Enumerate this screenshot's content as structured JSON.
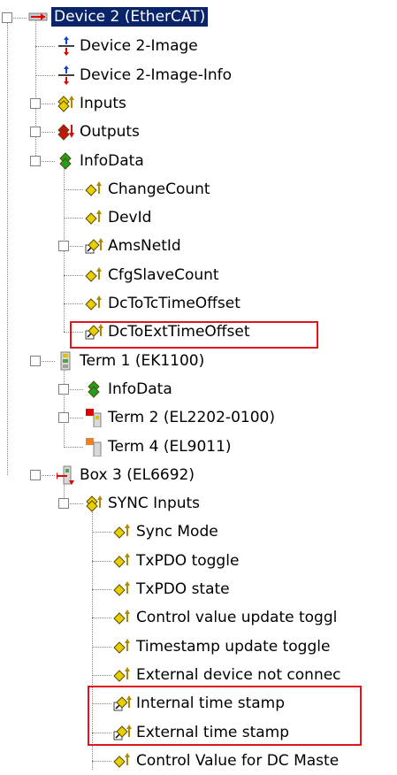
{
  "tree": {
    "nodes": [
      {
        "label": "Device 2 (EtherCAT)",
        "icon": "ethercat-device-icon",
        "expander": "−",
        "selected": true
      },
      {
        "label": "Device 2-Image",
        "icon": "process-image-icon"
      },
      {
        "label": "Device 2-Image-Info",
        "icon": "process-image-icon"
      },
      {
        "label": "Inputs",
        "icon": "input-variables-icon",
        "expander": "+"
      },
      {
        "label": "Outputs",
        "icon": "output-variables-icon",
        "expander": "+"
      },
      {
        "label": "InfoData",
        "icon": "infodata-icon",
        "expander": "−"
      },
      {
        "label": "ChangeCount",
        "icon": "input-variable-icon"
      },
      {
        "label": "DevId",
        "icon": "input-variable-icon"
      },
      {
        "label": "AmsNetId",
        "icon": "linked-input-variable-icon",
        "expander": "+"
      },
      {
        "label": "CfgSlaveCount",
        "icon": "input-variable-icon"
      },
      {
        "label": "DcToTcTimeOffset",
        "icon": "input-variable-icon"
      },
      {
        "label": "DcToExtTimeOffset",
        "icon": "linked-input-variable-icon"
      },
      {
        "label": "Term 1 (EK1100)",
        "icon": "coupler-terminal-icon",
        "expander": "−"
      },
      {
        "label": "InfoData",
        "icon": "infodata-icon",
        "expander": "+"
      },
      {
        "label": "Term 2 (EL2202-0100)",
        "icon": "digital-output-terminal-icon",
        "expander": "+"
      },
      {
        "label": "Term 4 (EL9011)",
        "icon": "end-terminal-icon"
      },
      {
        "label": "Box 3 (EL6692)",
        "icon": "bridge-terminal-icon",
        "expander": "−"
      },
      {
        "label": "SYNC Inputs",
        "icon": "input-group-icon",
        "expander": "−"
      },
      {
        "label": "Sync Mode",
        "icon": "input-variable-icon"
      },
      {
        "label": "TxPDO toggle",
        "icon": "input-variable-icon"
      },
      {
        "label": "TxPDO state",
        "icon": "input-variable-icon"
      },
      {
        "label": "Control value update toggl",
        "icon": "input-variable-icon"
      },
      {
        "label": "Timestamp update toggle",
        "icon": "input-variable-icon"
      },
      {
        "label": "External device not connec",
        "icon": "input-variable-icon"
      },
      {
        "label": "Internal time stamp",
        "icon": "linked-input-variable-icon"
      },
      {
        "label": "External time stamp",
        "icon": "linked-input-variable-icon"
      },
      {
        "label": "Control Value for DC Maste",
        "icon": "input-variable-icon"
      }
    ]
  },
  "colors": {
    "highlight_box": "#e0141e",
    "selection_bg": "#0a246a",
    "connector_line": "#808080"
  }
}
